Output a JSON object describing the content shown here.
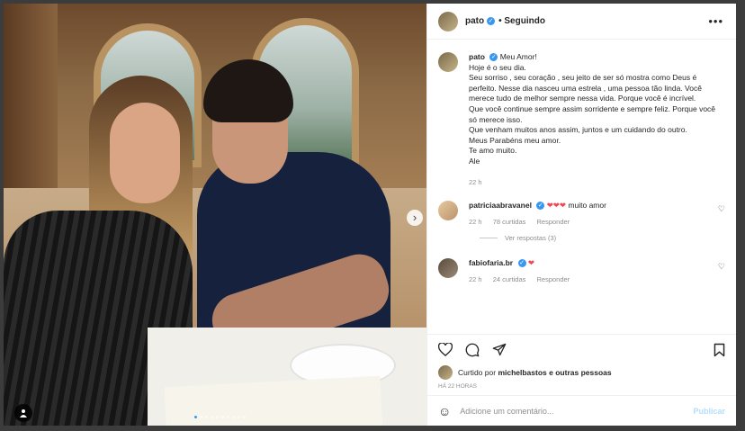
{
  "post": {
    "username": "pato",
    "follow_status": "Seguindo",
    "more": "•••",
    "caption_lines": [
      "Meu Amor!",
      "Hoje é o seu dia.",
      "Seu sorriso , seu coração , seu jeito de ser só mostra como Deus é perfeito. Nesse dia nasceu uma estrela , uma pessoa tão linda. Você merece tudo de melhor sempre nessa vida. Porque você é incrível.",
      "Que você continue sempre assim sorridente e sempre feliz. Porque você só merece isso.",
      "Que venham muitos anos assim, juntos e um cuidando do outro.",
      "Meus Parabéns meu amor.",
      "Te amo muito.",
      "Ale"
    ],
    "caption_time": "22 h",
    "time_ago": "HÁ 22 HORAS",
    "liked_by_prefix": "Curtido por",
    "liked_by_user": "michelbastos",
    "liked_by_suffix": "e outras pessoas"
  },
  "comments": [
    {
      "username": "patriciaabravanel",
      "hearts": "❤❤❤",
      "text": "muito amor",
      "time": "22 h",
      "likes": "78 curtidas",
      "reply_label": "Responder",
      "view_replies": "Ver respostas (3)"
    },
    {
      "username": "fabiofaria.br",
      "hearts": "❤",
      "text": "",
      "time": "22 h",
      "likes": "24 curtidas",
      "reply_label": "Responder"
    }
  ],
  "composer": {
    "placeholder": "Adicione um comentário...",
    "post_label": "Publicar"
  },
  "media": {
    "next_arrow": "›",
    "slide_count": 10,
    "active_slide": 1
  },
  "colors": {
    "verified": "#3897f0",
    "heart": "#ed4956",
    "post_button_disabled": "#b2dffc"
  },
  "icons": [
    "verified-badge-icon",
    "more-options-icon",
    "heart-icon",
    "comment-icon",
    "share-icon",
    "save-icon",
    "emoji-icon",
    "next-arrow-icon",
    "user-tag-icon"
  ]
}
